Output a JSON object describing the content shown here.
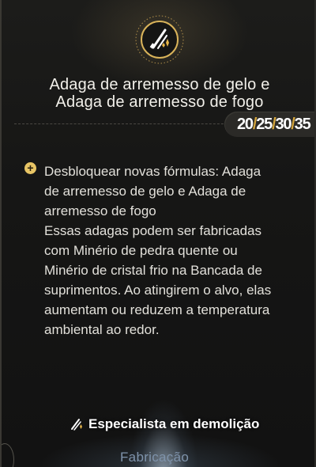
{
  "skill": {
    "icon": "throwing-dagger-icon",
    "title_line1": "Adaga de arremesso de gelo e",
    "title_line2": "Adaga de arremesso de fogo",
    "levels": [
      "20",
      "25",
      "30",
      "35"
    ],
    "level_separator": "/"
  },
  "effect": {
    "bullet_icon": "plus-circle-icon",
    "lines": [
      "Desbloquear novas fórmulas: Adaga",
      "de arremesso de gelo e Adaga de",
      "arremesso de fogo",
      "Essas adagas podem ser fabricadas",
      "com Minério de pedra quente ou",
      "Minério de cristal frio na Bancada de",
      "suprimentos. Ao atingirem o alvo, elas",
      "aumentam ou reduzem a temperatura",
      "ambiental ao redor."
    ]
  },
  "specialist": {
    "icon": "demolition-dagger-icon",
    "label": "Especialista em demolição"
  },
  "tab": {
    "label": "Fabricação"
  },
  "colors": {
    "accent_gold": "#d4a53c",
    "text": "#e2e0da",
    "tab_blue": "#7f93ab"
  }
}
